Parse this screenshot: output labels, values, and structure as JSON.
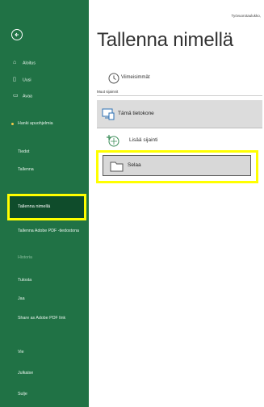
{
  "header": {
    "doc_name": "Työvuorotaulukko,"
  },
  "backstage": {
    "title": "Tallenna nimellä",
    "recent_label": "Viimeisimmät",
    "other_locations_header": "Muut sijainnit",
    "locations": [
      {
        "label": "Tämä tietokone",
        "icon": "computer-icon"
      },
      {
        "label": "Lisää sijainti",
        "icon": "add-location-icon"
      },
      {
        "label": "Selaa",
        "icon": "folder-icon"
      }
    ]
  },
  "sidebar": {
    "accent_color": "#207245",
    "items": [
      {
        "label": "Aloitus",
        "icon": "home-icon"
      },
      {
        "label": "Uusi",
        "icon": "new-document-icon"
      },
      {
        "label": "Avaa",
        "icon": "open-folder-icon"
      },
      {
        "label": "Hanki apuohjelmia"
      },
      {
        "label": "Tiedot"
      },
      {
        "label": "Tallenna"
      },
      {
        "label": "Tallenna nimellä"
      },
      {
        "label": "Tallenna Adobe PDF -tiedostona"
      },
      {
        "label": "Historia"
      },
      {
        "label": "Tulosta"
      },
      {
        "label": "Jaa"
      },
      {
        "label": "Share as Adobe PDF link"
      },
      {
        "label": "Vie"
      },
      {
        "label": "Julkaise"
      },
      {
        "label": "Sulje"
      }
    ]
  }
}
